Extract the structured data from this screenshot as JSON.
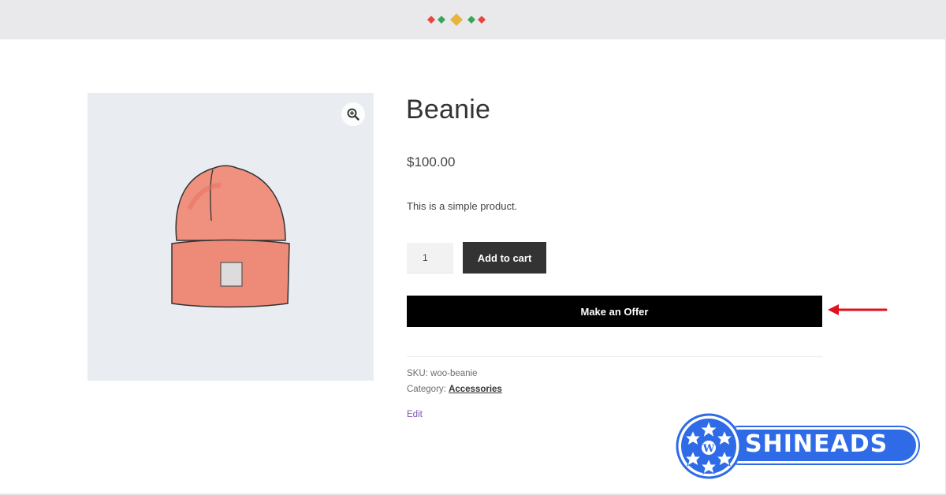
{
  "header": {
    "logo_icon": "diamond-row-icon",
    "colors": [
      "#e8453c",
      "#34a853",
      "#e7b43c",
      "#34a853",
      "#e8453c"
    ]
  },
  "product": {
    "title": "Beanie",
    "price": "$100.00",
    "description": "This is a simple product.",
    "quantity": "1",
    "add_to_cart_label": "Add to cart",
    "make_offer_label": "Make an Offer",
    "sku_label": "SKU:",
    "sku_value": "woo-beanie",
    "category_label": "Category:",
    "category_value": "Accessories",
    "edit_label": "Edit"
  },
  "gallery": {
    "zoom_icon": "zoom-in-icon",
    "image": "beanie-image"
  },
  "annotation": {
    "arrow_icon": "red-arrow-icon",
    "arrow_color": "#e0101e"
  },
  "brand": {
    "text": "SHINEADS",
    "color": "#2f6be6"
  }
}
